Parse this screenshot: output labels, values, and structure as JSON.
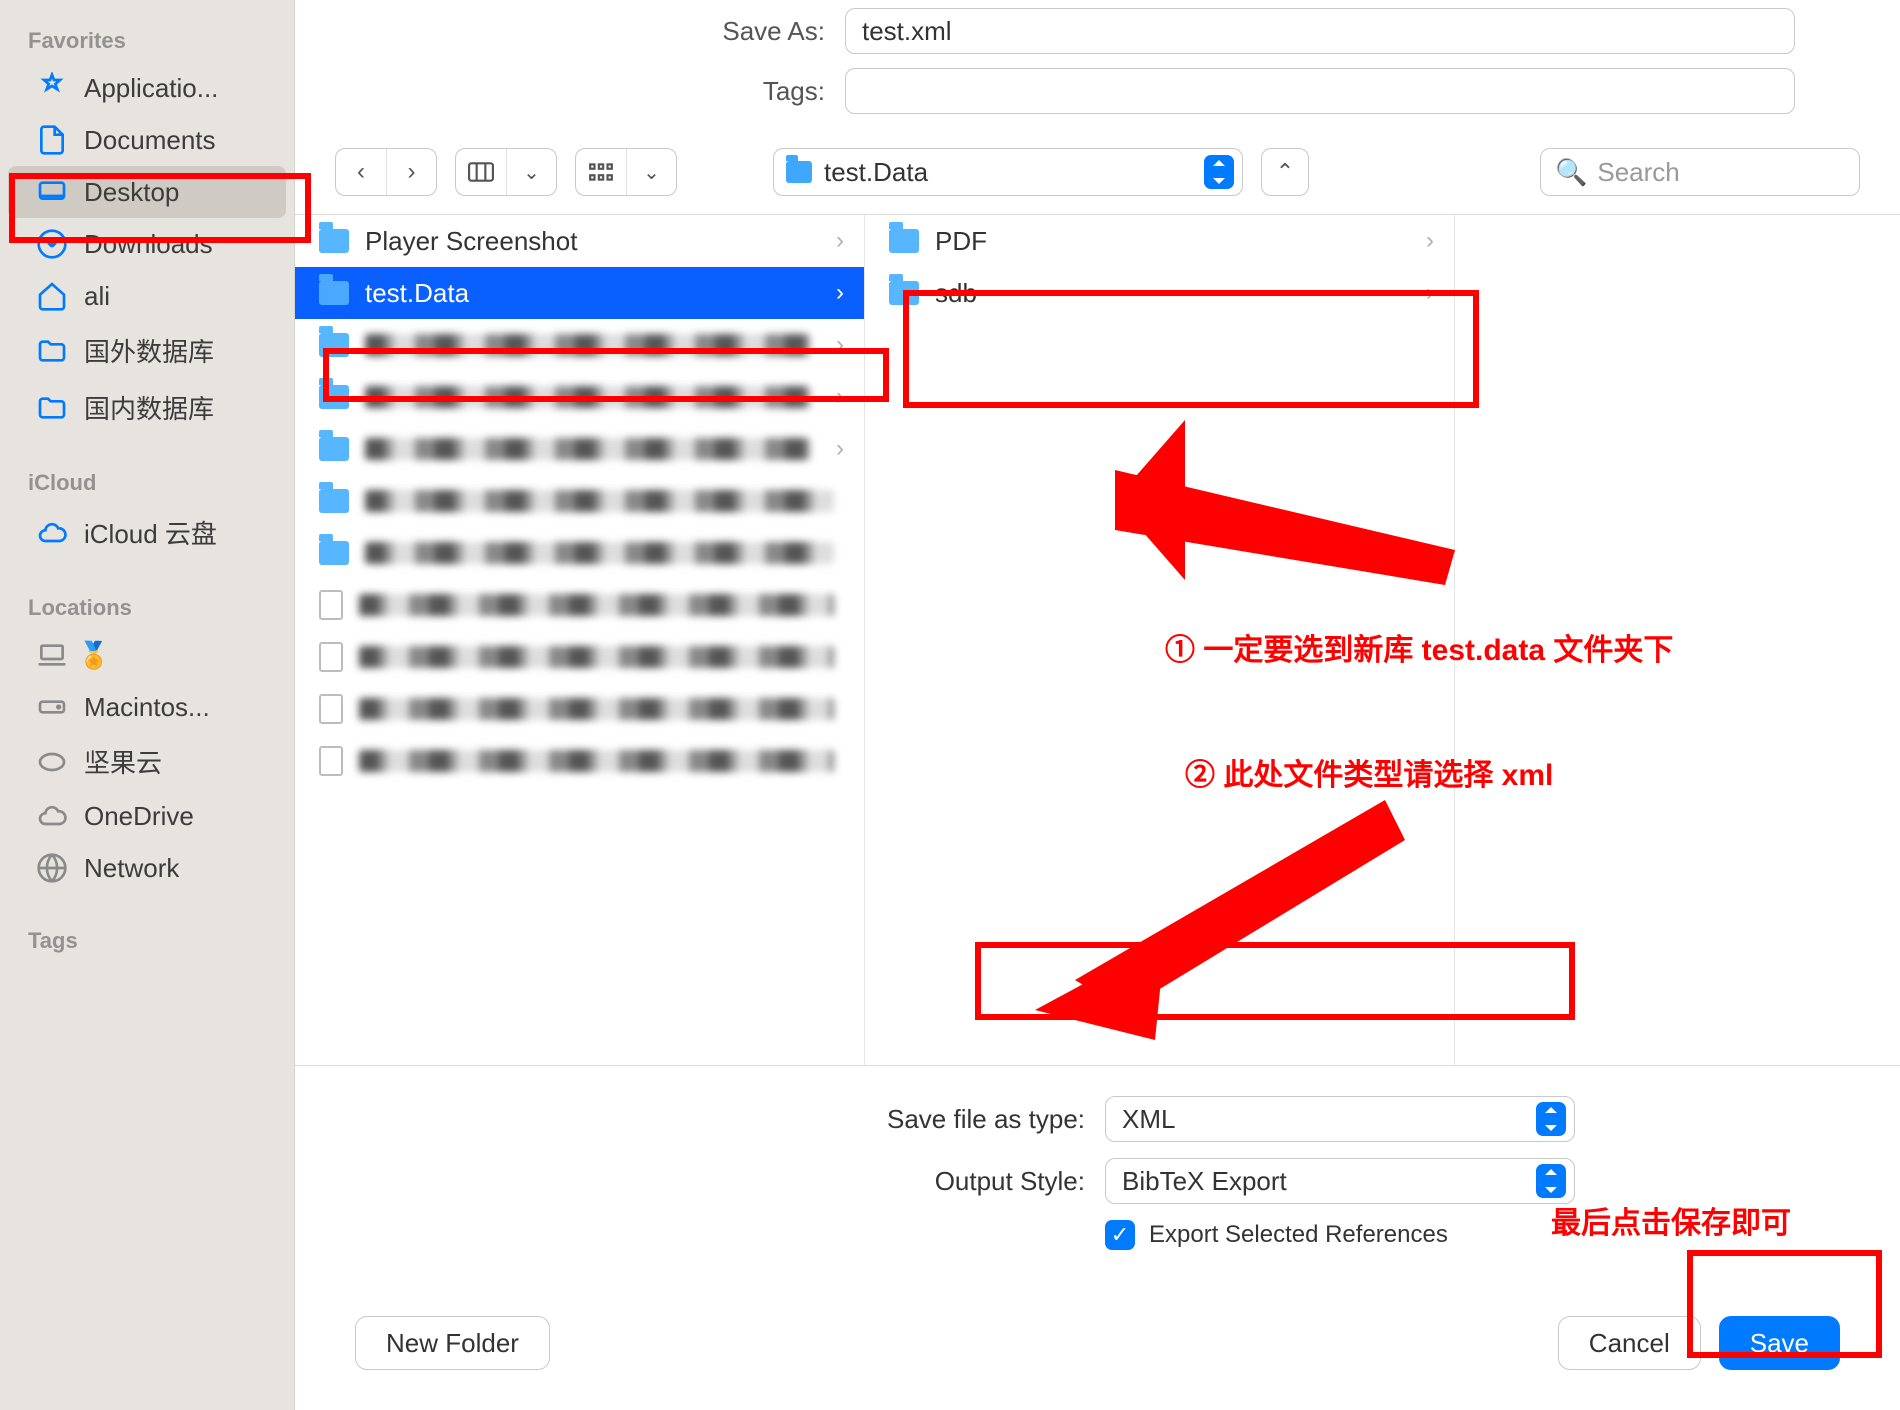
{
  "sidebar": {
    "sections": {
      "favorites": {
        "header": "Favorites",
        "items": [
          {
            "label": "Applicatio..."
          },
          {
            "label": "Documents"
          },
          {
            "label": "Desktop"
          },
          {
            "label": "Downloads"
          },
          {
            "label": "ali"
          },
          {
            "label": "国外数据库"
          },
          {
            "label": "国内数据库"
          }
        ]
      },
      "icloud": {
        "header": "iCloud",
        "items": [
          {
            "label": "iCloud 云盘"
          }
        ]
      },
      "locations": {
        "header": "Locations",
        "items": [
          {
            "label": ""
          },
          {
            "label": "Macintos..."
          },
          {
            "label": "坚果云"
          },
          {
            "label": "OneDrive"
          },
          {
            "label": "Network"
          }
        ]
      },
      "tags": {
        "header": "Tags"
      }
    }
  },
  "form": {
    "saveas_label": "Save As:",
    "saveas_value": "test.xml",
    "tags_label": "Tags:"
  },
  "toolbar": {
    "location": "test.Data",
    "search_placeholder": "Search"
  },
  "columns": {
    "col1": [
      {
        "name": "Player Screenshot",
        "chev": true
      },
      {
        "name": "test.Data",
        "chev": true,
        "selected": true
      }
    ],
    "col2": [
      {
        "name": "PDF",
        "chev": true
      },
      {
        "name": "sdb",
        "chev": true
      }
    ]
  },
  "options": {
    "filetype_label": "Save file as type:",
    "filetype_value": "XML",
    "style_label": "Output Style:",
    "style_value": "BibTeX Export",
    "export_selected": "Export Selected References"
  },
  "footer": {
    "newfolder": "New Folder",
    "cancel": "Cancel",
    "save": "Save"
  },
  "annotations": {
    "a1": "① 一定要选到新库 test.data 文件夹下",
    "a2": "② 此处文件类型请选择 xml",
    "a3": "最后点击保存即可"
  }
}
